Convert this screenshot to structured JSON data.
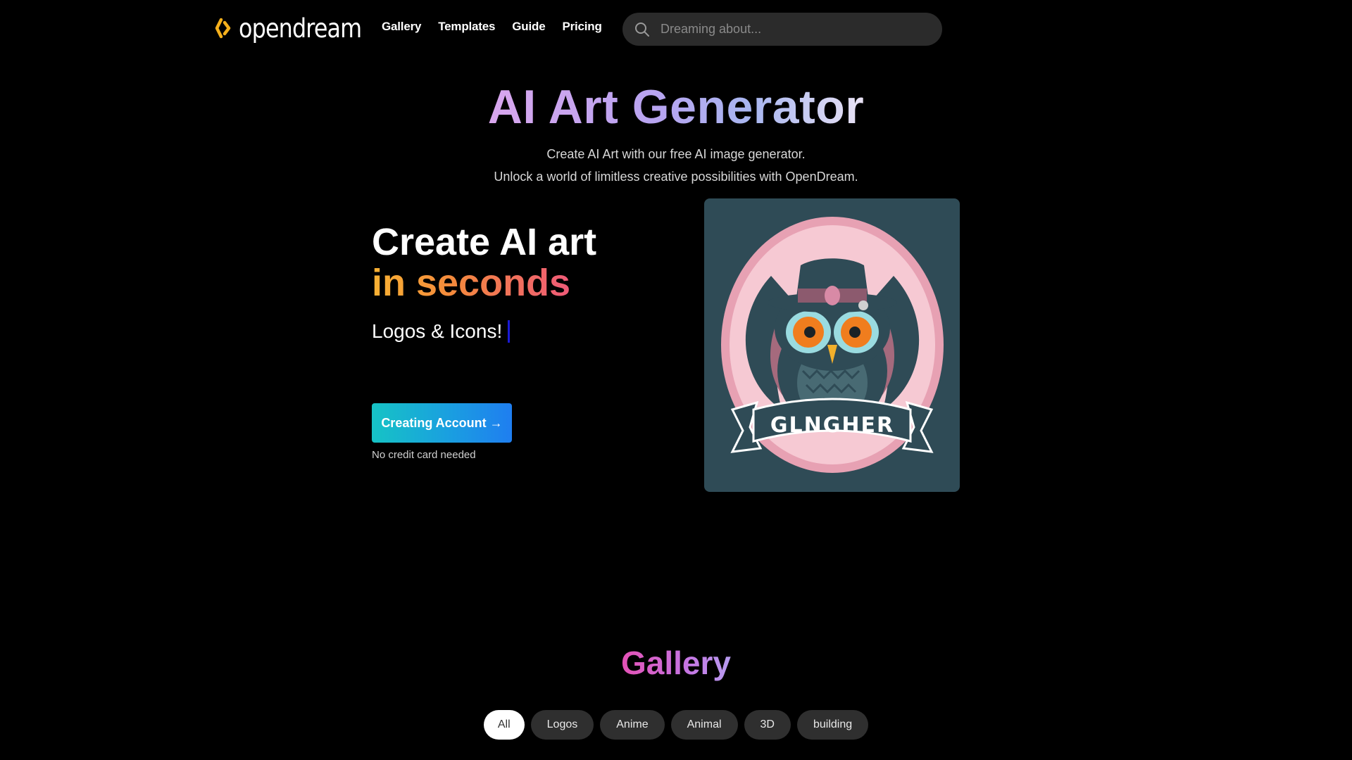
{
  "header": {
    "logo_text": "opendream",
    "nav": [
      {
        "label": "Gallery"
      },
      {
        "label": "Templates"
      },
      {
        "label": "Guide"
      },
      {
        "label": "Pricing"
      }
    ],
    "search": {
      "placeholder": "Dreaming about...",
      "icon": "search-icon"
    }
  },
  "hero": {
    "title": "AI Art Generator",
    "subtitle_line1": "Create AI Art with our free AI image generator.",
    "subtitle_line2": "Unlock a world of limitless creative possibilities with OpenDream."
  },
  "promo": {
    "headline_line1": "Create AI art",
    "headline_line2": "in seconds",
    "typing_text": "Logos & Icons!",
    "cta_label": "Creating Account →",
    "cta_note": "No credit card needed",
    "image_text": "GLNGHER"
  },
  "gallery": {
    "title": "Gallery",
    "filters": [
      {
        "label": "All",
        "active": true
      },
      {
        "label": "Logos"
      },
      {
        "label": "Anime"
      },
      {
        "label": "Animal"
      },
      {
        "label": "3D"
      },
      {
        "label": "building"
      }
    ]
  },
  "colors": {
    "background": "#000000",
    "logo_accent": "#f5b01c",
    "cta_gradient": [
      "#16c3c5",
      "#1f7ef0"
    ],
    "art_background": "#2f4b56"
  }
}
